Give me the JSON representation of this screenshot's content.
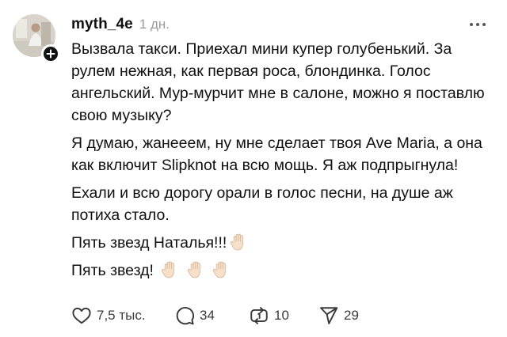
{
  "post": {
    "username": "myth_4e",
    "time": "1 дн.",
    "paragraphs": [
      "Вызвала такси. Приехал мини купер голубенький. За рулем нежная, как первая роса, блондинка. Голос ангельский. Мур-мурчит мне в салоне, можно я поставлю свою музыку?",
      "Я думаю, жанееем, ну мне сделает твоя Ave Maria, а она как включит Slipknot на всю мощь. Я аж подпрыгнула!",
      "Ехали и всю дорогу орали в голос песни, на душе аж потиха стало.",
      "Пять звезд Наталья!!!",
      "Пять звезд!"
    ]
  },
  "actions": {
    "likes": "7,5 тыс.",
    "comments": "34",
    "reposts": "10",
    "shares": "29"
  },
  "icons": {
    "like": "heart-icon",
    "comment": "speech-bubble-icon",
    "repost": "repost-arrows-icon",
    "share": "paper-plane-icon",
    "more": "more-dots-icon",
    "follow": "plus-icon",
    "emoji": "raised-hand-emoji"
  },
  "colors": {
    "text": "#101010",
    "muted": "#9a9a9a",
    "icon": "#3a3a3a",
    "emoji_skin": "#f7dfc8"
  }
}
